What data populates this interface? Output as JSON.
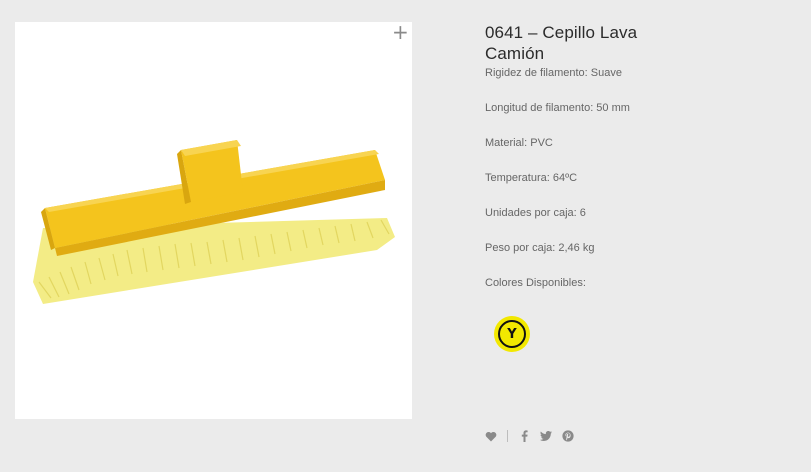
{
  "product": {
    "title": "0641 – Cepillo Lava Camión",
    "specs": [
      "Rigidez de filamento: Suave",
      "Longitud de filamento: 50 mm",
      "Material: PVC",
      "Temperatura: 64ºC",
      "Unidades por caja: 6",
      "Peso por caja: 2,46 kg",
      "Colores Disponibles:"
    ],
    "colors": [
      {
        "label": "Y",
        "hex": "#f2e800"
      }
    ]
  },
  "image": {
    "zoom_glyph": "+"
  },
  "share": {
    "icons": [
      "heart-icon",
      "facebook-icon",
      "twitter-icon",
      "pinterest-icon"
    ]
  },
  "colors": {
    "background": "#ebebeb",
    "brush_yellow": "#f4c41d",
    "bristle": "#f5ee8a",
    "swatch_yellow": "#f2e800"
  }
}
